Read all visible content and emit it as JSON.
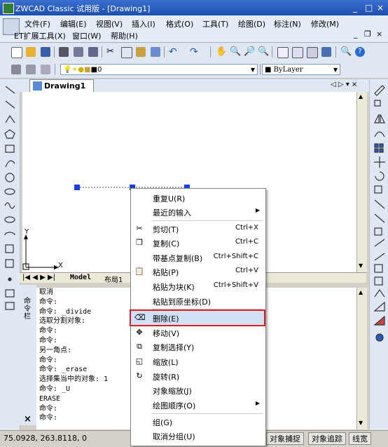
{
  "window": {
    "title": "ZWCAD Classic 试用版 - [Drawing1]",
    "controls": [
      "_",
      "□",
      "×"
    ],
    "mdi_controls": [
      "_",
      "❐",
      "×"
    ]
  },
  "menu": {
    "row1": [
      "文件(F)",
      "编辑(E)",
      "视图(V)",
      "插入(I)",
      "格式(O)",
      "工具(T)",
      "绘图(D)",
      "标注(N)",
      "修改(M)"
    ],
    "row2": [
      "ET扩展工具(X)",
      "窗口(W)",
      "帮助(H)"
    ]
  },
  "toolbar": {
    "layer_value": "0",
    "linetype_value": "ByLayer"
  },
  "tabs": {
    "drawing": "Drawing1",
    "nav": "◁ ▷ ▾ ×",
    "model": "Model",
    "layout1": "布局1"
  },
  "ucs": {
    "x_label": "X",
    "y_label": "Y"
  },
  "command": {
    "side_label": "命令栏",
    "lines": [
      "取消",
      "命令:",
      "命令: _divide",
      "选取分割对象:",
      "命令:",
      "命令:",
      "另一角点:",
      "命令:",
      "命令: _erase",
      "选择集当中的对象: 1",
      "命令: _U",
      "ERASE",
      "命令:",
      "命令:"
    ],
    "close": "×"
  },
  "status": {
    "coords": "75.0928,  263.8118,  0",
    "buttons": [
      "对象捕捉",
      "对象追踪",
      "线宽"
    ]
  },
  "context_menu": {
    "items": [
      {
        "label": "重复U(R)",
        "shortcut": "",
        "submenu": false,
        "icon": ""
      },
      {
        "label": "最近的输入",
        "shortcut": "",
        "submenu": true,
        "icon": ""
      },
      {
        "label": "剪切(T)",
        "shortcut": "Ctrl+X",
        "submenu": false,
        "icon": "✂"
      },
      {
        "label": "复制(C)",
        "shortcut": "Ctrl+C",
        "submenu": false,
        "icon": "❐"
      },
      {
        "label": "带基点复制(B)",
        "shortcut": "Ctrl+Shift+C",
        "submenu": false,
        "icon": ""
      },
      {
        "label": "粘贴(P)",
        "shortcut": "Ctrl+V",
        "submenu": false,
        "icon": "📋"
      },
      {
        "label": "粘贴为块(K)",
        "shortcut": "Ctrl+Shift+V",
        "submenu": false,
        "icon": ""
      },
      {
        "label": "粘贴到原坐标(D)",
        "shortcut": "",
        "submenu": false,
        "icon": ""
      },
      {
        "label": "删除(E)",
        "shortcut": "",
        "submenu": false,
        "icon": "⌫"
      },
      {
        "label": "移动(V)",
        "shortcut": "",
        "submenu": false,
        "icon": "✥"
      },
      {
        "label": "复制选择(Y)",
        "shortcut": "",
        "submenu": false,
        "icon": "⧉"
      },
      {
        "label": "缩放(L)",
        "shortcut": "",
        "submenu": false,
        "icon": "◱"
      },
      {
        "label": "旋转(R)",
        "shortcut": "",
        "submenu": false,
        "icon": "↻"
      },
      {
        "label": "对象缩放(J)",
        "shortcut": "",
        "submenu": false,
        "icon": ""
      },
      {
        "label": "绘图顺序(O)",
        "shortcut": "",
        "submenu": true,
        "icon": ""
      },
      {
        "label": "组(G)",
        "shortcut": "",
        "submenu": false,
        "icon": ""
      },
      {
        "label": "取消分组(U)",
        "shortcut": "",
        "submenu": false,
        "icon": ""
      }
    ],
    "highlighted": "删除(E)"
  }
}
